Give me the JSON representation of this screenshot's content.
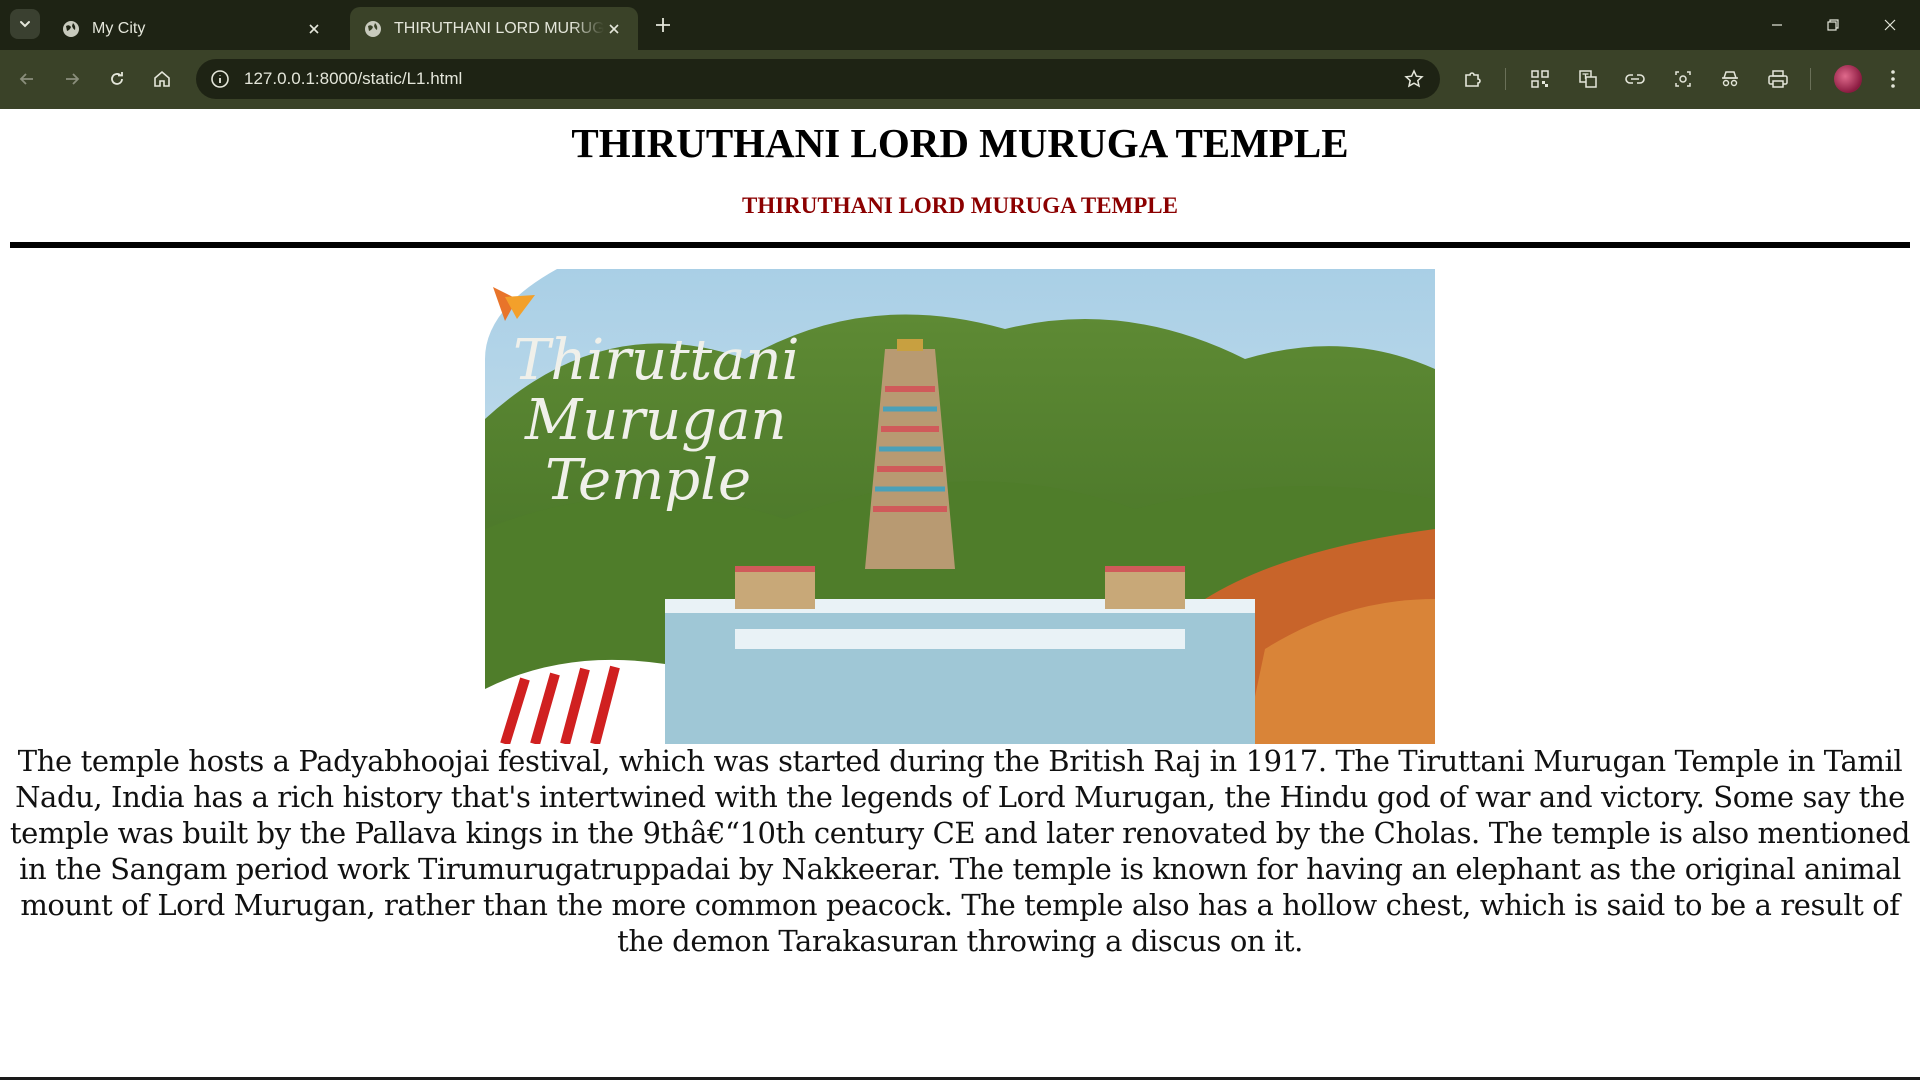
{
  "browser": {
    "tabs": [
      {
        "title": "My City",
        "active": false
      },
      {
        "title": "THIRUTHANI LORD MURUGA TEMPLE",
        "active": true
      }
    ],
    "url": "127.0.0.1:8000/static/L1.html",
    "colors": {
      "frame": "#1e2314",
      "toolbar": "#3a4228",
      "text": "#e4e6da"
    }
  },
  "page": {
    "heading": "THIRUTHANI LORD MURUGA TEMPLE",
    "subheading": "THIRUTHANI LORD MURUGA TEMPLE",
    "subheading_color": "#8b0000",
    "image": {
      "overlay_text_lines": [
        "Thiruttani",
        "Murugan",
        "Temple"
      ],
      "logo": "orange-bird-logo"
    },
    "paragraph": "The temple hosts a Padyabhoojai festival, which was started during the British Raj in 1917. The Tiruttani Murugan Temple in Tamil Nadu, India has a rich history that's intertwined with the legends of Lord Murugan, the Hindu god of war and victory. Some say the temple was built by the Pallava kings in the 9thâ€“10th century CE and later renovated by the Cholas. The temple is also mentioned in the Sangam period work Tirumurugatruppadai by Nakkeerar. The temple is known for having an elephant as the original animal mount of Lord Murugan, rather than the more common peacock. The temple also has a hollow chest, which is said to be a result of the demon Tarakasuran throwing a discus on it."
  }
}
